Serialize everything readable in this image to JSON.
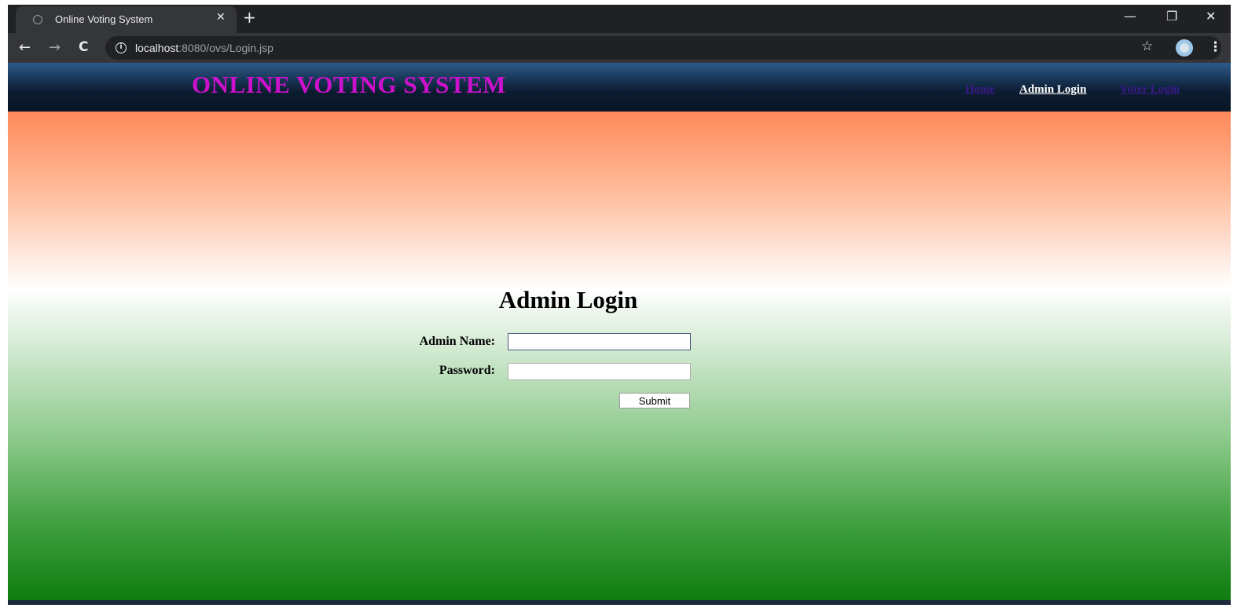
{
  "browser": {
    "tab_title": "Online Voting System",
    "tab_close": "✕",
    "new_tab": "+",
    "window_controls": {
      "minimize": "—",
      "restore": "❐",
      "close": "✕"
    },
    "nav": {
      "back": "←",
      "forward": "→",
      "reload": "C"
    },
    "address": {
      "info": "i",
      "host": "localhost",
      "rest": ":8080/ovs/Login.jsp"
    },
    "bookmark_star": "☆",
    "menu": "⋮"
  },
  "site": {
    "title": "ONLINE VOTING SYSTEM",
    "nav": [
      {
        "label": "Home",
        "color": "#3a1a8a"
      },
      {
        "label": "Admin Login",
        "color": "#ffffff"
      },
      {
        "label": "Voter Login",
        "color": "#3a1a8a"
      }
    ],
    "title_color": "#cc11cc"
  },
  "login_form": {
    "heading": "Admin Login",
    "admin_name_label": "Admin Name:",
    "admin_name_value": "",
    "password_label": "Password:",
    "password_value": "",
    "submit_label": "Submit"
  },
  "colors": {
    "saffron": "#ff6a32",
    "white": "#ffffff",
    "green": "#0f7d0f"
  }
}
